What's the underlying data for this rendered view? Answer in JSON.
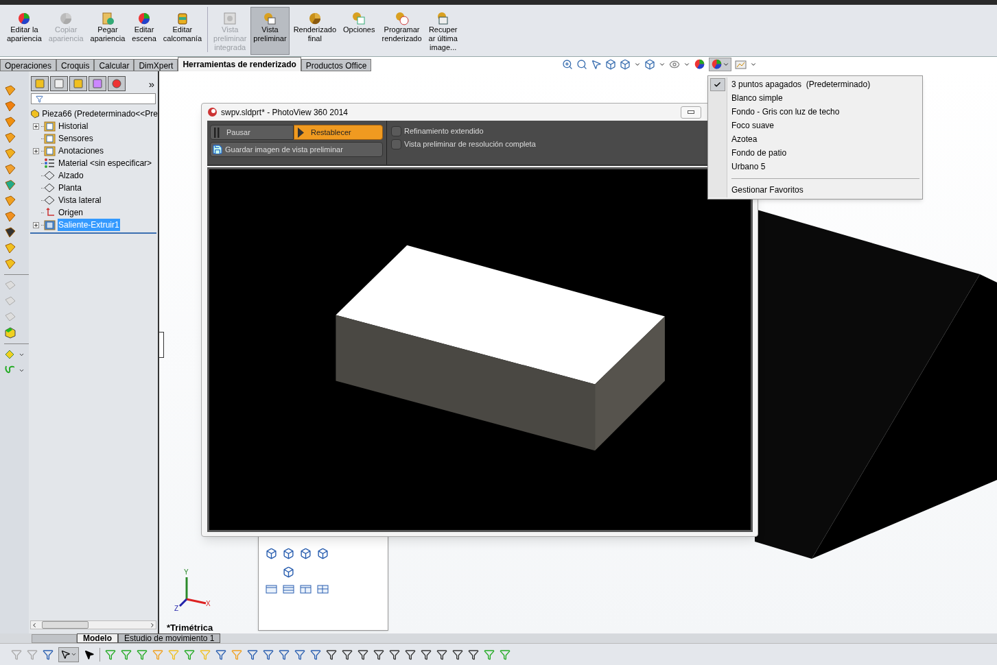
{
  "ribbon": {
    "buttons": [
      {
        "label": "Editar la\napariencia",
        "disabled": false,
        "selected": false
      },
      {
        "label": "Copiar\napariencia",
        "disabled": true,
        "selected": false
      },
      {
        "label": "Pegar\napariencia",
        "disabled": false,
        "selected": false
      },
      {
        "label": "Editar\nescena",
        "disabled": false,
        "selected": false
      },
      {
        "label": "Editar\ncalcomanía",
        "disabled": false,
        "selected": false
      },
      {
        "label": "Vista\npreliminar\nintegrada",
        "disabled": true,
        "selected": false
      },
      {
        "label": "Vista\npreliminar",
        "disabled": false,
        "selected": true
      },
      {
        "label": "Renderizado\nfinal",
        "disabled": false,
        "selected": false
      },
      {
        "label": "Opciones",
        "disabled": false,
        "selected": false
      },
      {
        "label": "Programar\nrenderizado",
        "disabled": false,
        "selected": false
      },
      {
        "label": "Recuper\nar última\nimage...",
        "disabled": false,
        "selected": false
      }
    ]
  },
  "tabs": [
    {
      "label": "Operaciones",
      "selected": false
    },
    {
      "label": "Croquis",
      "selected": false
    },
    {
      "label": "Calcular",
      "selected": false
    },
    {
      "label": "DimXpert",
      "selected": false
    },
    {
      "label": "Herramientas de renderizado",
      "selected": true
    },
    {
      "label": "Productos Office",
      "selected": false
    }
  ],
  "feature_tree": {
    "more": "»",
    "root": "Pieza66  (Predeterminado<<Pre",
    "items": [
      {
        "label": "Historial",
        "expandable": true,
        "selected": false
      },
      {
        "label": "Sensores",
        "expandable": false,
        "selected": false
      },
      {
        "label": "Anotaciones",
        "expandable": true,
        "selected": false
      },
      {
        "label": "Material <sin especificar>",
        "expandable": false,
        "selected": false
      },
      {
        "label": "Alzado",
        "expandable": false,
        "selected": false
      },
      {
        "label": "Planta",
        "expandable": false,
        "selected": false
      },
      {
        "label": "Vista lateral",
        "expandable": false,
        "selected": false
      },
      {
        "label": "Origen",
        "expandable": false,
        "selected": false
      },
      {
        "label": "Saliente-Extruir1",
        "expandable": true,
        "selected": true
      }
    ]
  },
  "viewport": {
    "view_label": "*Trimétrica",
    "axes": {
      "y": "Y",
      "x": "X",
      "z": "Z"
    }
  },
  "photoview": {
    "title": "swpv.sldprt* - PhotoView 360 2014",
    "pause": "Pausar",
    "reset": "Restablecer",
    "save": "Guardar imagen de vista preliminar",
    "options": [
      {
        "label": "Refinamiento extendido",
        "checked": false
      },
      {
        "label": "Vista preliminar de resolución completa",
        "checked": false
      }
    ]
  },
  "scene_menu": {
    "items": [
      {
        "label": "3 puntos apagados  (Predeterminado)",
        "checked": true
      },
      {
        "label": "Blanco simple",
        "checked": false
      },
      {
        "label": "Fondo - Gris con luz de techo",
        "checked": false
      },
      {
        "label": "Foco suave",
        "checked": false
      },
      {
        "label": "Azotea",
        "checked": false
      },
      {
        "label": "Fondo de patio",
        "checked": false
      },
      {
        "label": "Urbano 5",
        "checked": false
      }
    ],
    "footer": "Gestionar Favoritos"
  },
  "bottom_tabs": [
    {
      "label": "Modelo",
      "selected": true
    },
    {
      "label": "Estudio de movimiento 1",
      "selected": false
    }
  ]
}
